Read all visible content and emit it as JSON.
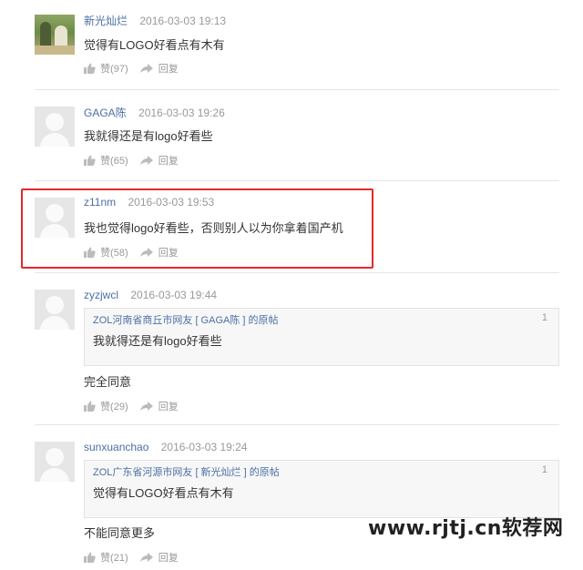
{
  "comments": [
    {
      "username": "新光灿烂",
      "time": "2016-03-03 19:13",
      "text": "觉得有LOGO好看点有木有",
      "like_label": "赞(97)",
      "reply_label": "回复",
      "avatar": "photo"
    },
    {
      "username": "GAGA陈",
      "time": "2016-03-03 19:26",
      "text": "我就得还是有logo好看些",
      "like_label": "赞(65)",
      "reply_label": "回复",
      "avatar": "default"
    },
    {
      "username": "z11nm",
      "time": "2016-03-03 19:53",
      "text": "我也觉得logo好看些，否则别人以为你拿着国产机",
      "like_label": "赞(58)",
      "reply_label": "回复",
      "avatar": "default",
      "highlighted": true
    },
    {
      "username": "zyzjwcl",
      "time": "2016-03-03 19:44",
      "quote": {
        "header": "ZOL河南省商丘市网友 [ GAGA陈 ] 的原帖",
        "floor": "1",
        "text": "我就得还是有logo好看些"
      },
      "text": "完全同意",
      "like_label": "赞(29)",
      "reply_label": "回复",
      "avatar": "default"
    },
    {
      "username": "sunxuanchao",
      "time": "2016-03-03 19:24",
      "quote": {
        "header": "ZOL广东省河源市网友 [ 新光灿烂 ] 的原帖",
        "floor": "1",
        "text": "觉得有LOGO好看点有木有"
      },
      "text": "不能同意更多",
      "like_label": "赞(21)",
      "reply_label": "回复",
      "avatar": "default"
    }
  ],
  "watermark": "www.rjtj.cn软荐网",
  "colors": {
    "username": "#4a6fa5",
    "highlight_border": "#e8272c",
    "muted": "#999999"
  },
  "icons": {
    "like": "thumbs-up-icon",
    "reply": "reply-arrow-icon"
  }
}
